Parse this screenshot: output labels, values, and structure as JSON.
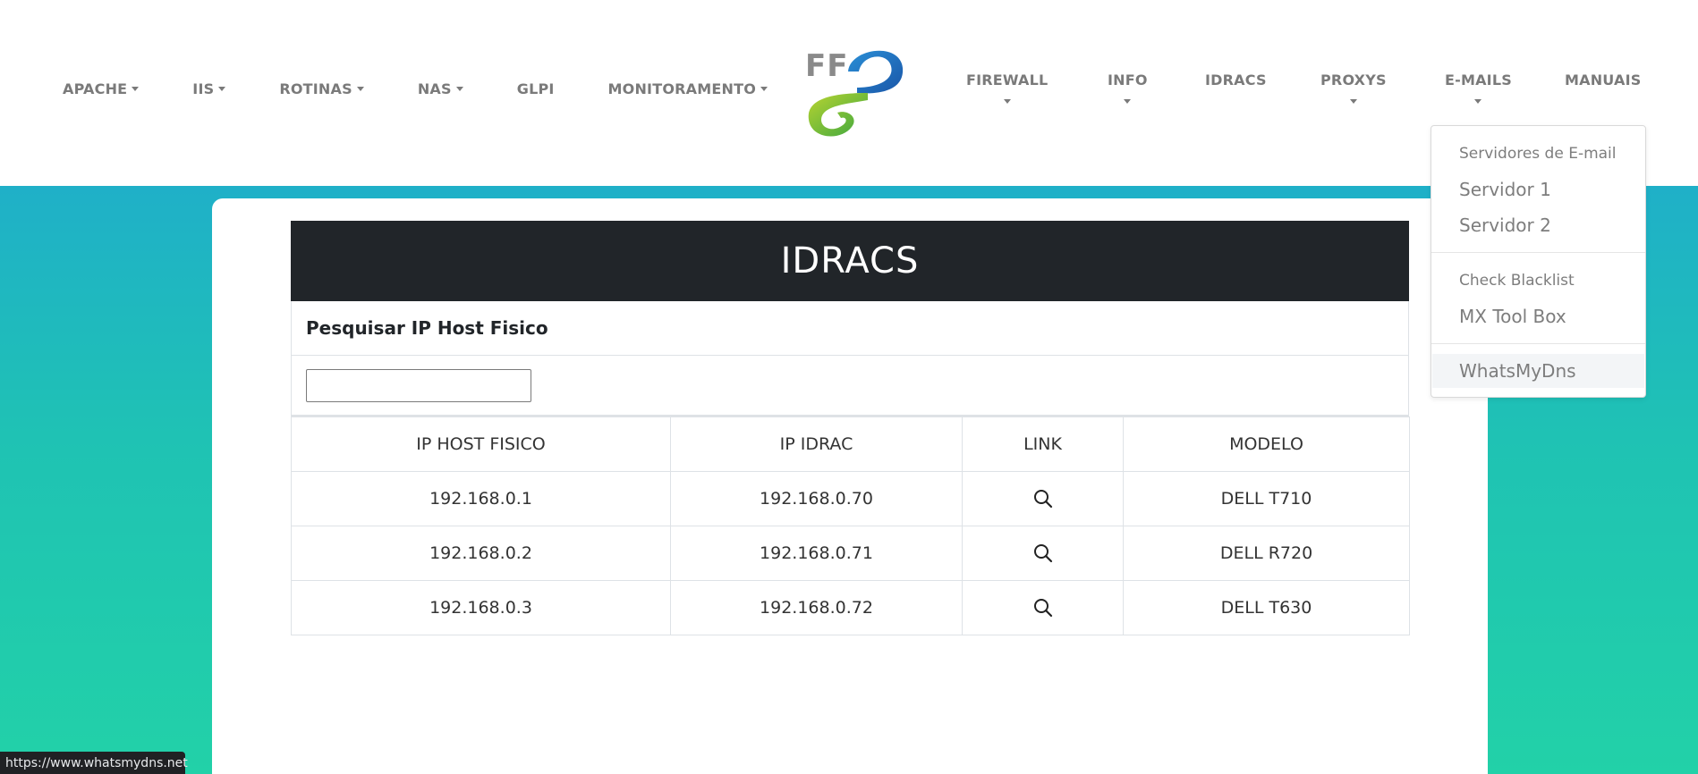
{
  "nav": {
    "left": [
      {
        "label": "APACHE",
        "dropdown": true
      },
      {
        "label": "IIS",
        "dropdown": true
      },
      {
        "label": "ROTINAS",
        "dropdown": true
      },
      {
        "label": "NAS",
        "dropdown": true
      },
      {
        "label": "GLPI",
        "dropdown": false
      },
      {
        "label": "MONITORAMENTO",
        "dropdown": true
      }
    ],
    "logo_text": "FF",
    "right": [
      {
        "label": "FIREWALL",
        "dropdown": true
      },
      {
        "label": "INFO",
        "dropdown": true
      },
      {
        "label": "IDRACS",
        "dropdown": false
      },
      {
        "label": "PROXYS",
        "dropdown": true
      },
      {
        "label": "E-MAILS",
        "dropdown": true
      },
      {
        "label": "MANUAIS",
        "dropdown": false
      }
    ]
  },
  "dropdown": {
    "header1": "Servidores de E-mail",
    "item1": "Servidor 1",
    "item2": "Servidor 2",
    "header2": "Check Blacklist",
    "item3": "MX Tool Box",
    "item4": "WhatsMyDns"
  },
  "main": {
    "title": "IDRACS",
    "search_label": "Pesquisar IP Host Fisico",
    "search_value": "",
    "columns": [
      "IP HOST FISICO",
      "IP IDRAC",
      "LINK",
      "MODELO"
    ],
    "rows": [
      {
        "host": "192.168.0.1",
        "idrac": "192.168.0.70",
        "link_icon": "search-icon",
        "model": "DELL T710"
      },
      {
        "host": "192.168.0.2",
        "idrac": "192.168.0.71",
        "link_icon": "search-icon",
        "model": "DELL R720"
      },
      {
        "host": "192.168.0.3",
        "idrac": "192.168.0.72",
        "link_icon": "search-icon",
        "model": "DELL T630"
      }
    ]
  },
  "statusbar": {
    "url": "https://www.whatsmydns.net"
  },
  "colors": {
    "nav_text": "#7a7a7a",
    "title_bar": "#212529",
    "bg_top": "#1fb0c8",
    "bg_bottom": "#22d1a8"
  }
}
